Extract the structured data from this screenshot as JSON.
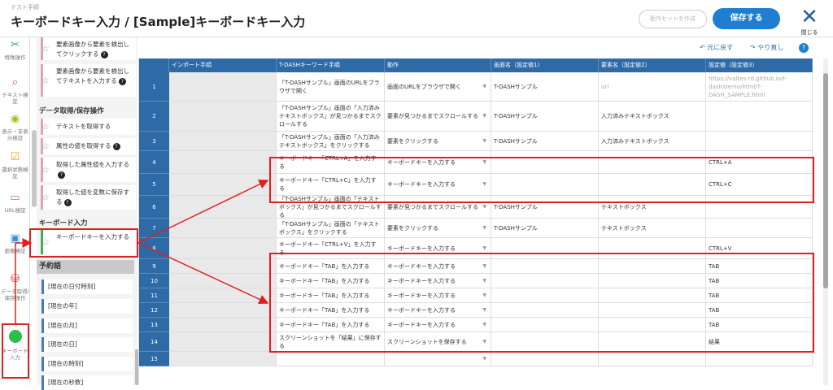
{
  "header": {
    "breadcrumb": "テスト手順",
    "title": "キーボードキー入力 / [Sample]キーボードキー入力",
    "secondary_button": "動作セットを作成",
    "save_button": "保存する",
    "close_label": "閉じる"
  },
  "rail": [
    {
      "label": "特殊操作",
      "icon": "tools-icon",
      "glyph": "✂",
      "color": "#3aaa55"
    },
    {
      "label": "テキスト検証",
      "icon": "magnifier-icon",
      "glyph": "⌕",
      "color": "#c44"
    },
    {
      "label": "表示・非表示検証",
      "icon": "eye-icon",
      "glyph": "◉",
      "color": "#9bc21e"
    },
    {
      "label": "選択状態検証",
      "icon": "checkbox-icon",
      "glyph": "☑",
      "color": "#e8a31a"
    },
    {
      "label": "URL検証",
      "icon": "url-icon",
      "glyph": "▭",
      "color": "#d66"
    },
    {
      "label": "画像検証",
      "icon": "image-icon",
      "glyph": "▣",
      "color": "#3a8fd0"
    },
    {
      "label": "データ取得/保存操作",
      "icon": "database-icon",
      "glyph": "⛁",
      "color": "#c43"
    },
    {
      "label": "キーボード入力",
      "icon": "keyboard-icon",
      "glyph": "",
      "color": "#2cbf4c"
    }
  ],
  "panel": {
    "items_top": [
      {
        "label": "要素画像から要素を検出してクリックする",
        "help": "?"
      },
      {
        "label": "要素画像から要素を検出してテキストを入力する",
        "help": "?"
      }
    ],
    "section_data": "データ取得/保存操作",
    "items_data": [
      {
        "label": "テキストを取得する",
        "help": ""
      },
      {
        "label": "属性の値を取得する",
        "help": "?"
      },
      {
        "label": "取得した属性値を入力する",
        "help": "?"
      },
      {
        "label": "取得した値を変数に保存する",
        "help": "?"
      }
    ],
    "section_keyboard": "キーボード入力",
    "keyboard_item": "キーボードキーを入力する",
    "section_reserved": "予約語",
    "reserved": [
      "[現在の日付時刻]",
      "[現在の年]",
      "[現在の月]",
      "[現在の日]",
      "[現在の時刻]",
      "[現在の秒数]"
    ]
  },
  "toolbar": {
    "undo": "元に戻す",
    "redo": "やり直し",
    "help": "?"
  },
  "grid": {
    "columns": [
      "インポート手順",
      "T-DASHキーワード手順",
      "動作",
      "画面名（設定値1）",
      "要素名（設定値2）",
      "設定値（設定値3）"
    ],
    "rows": [
      {
        "num": "1",
        "step": "「T-DASHサンプル」画面のURLをブラウザで開く",
        "action": "画面のURLをブラウザで開く",
        "v1": "T-DASHサンプル",
        "v2": "url",
        "v3": "https://valtes-rd.github.io/t-dash/demo/html/T-DASH_SAMPLE.html"
      },
      {
        "num": "2",
        "step": "「T-DASHサンプル」画面の「入力済みテキストボックス」が見つかるまでスクロールする",
        "action": "要素が見つかるまでスクロールする",
        "v1": "T-DASHサンプル",
        "v2": "入力済みテキストボックス",
        "v3": ""
      },
      {
        "num": "3",
        "step": "「T-DASHサンプル」画面の「入力済みテキストボックス」をクリックする",
        "action": "要素をクリックする",
        "v1": "T-DASHサンプル",
        "v2": "入力済みテキストボックス",
        "v3": ""
      },
      {
        "num": "4",
        "step": "キーボードキー「CTRL+A」を入力する",
        "action": "キーボードキーを入力する",
        "v1": "",
        "v2": "",
        "v3": "CTRL+A"
      },
      {
        "num": "5",
        "step": "キーボードキー「CTRL+C」を入力する",
        "action": "キーボードキーを入力する",
        "v1": "",
        "v2": "",
        "v3": "CTRL+C"
      },
      {
        "num": "6",
        "step": "「T-DASHサンプル」画面の「テキストボックス」が見つかるまでスクロールする",
        "action": "要素が見つかるまでスクロールする",
        "v1": "T-DASHサンプル",
        "v2": "テキストボックス",
        "v3": ""
      },
      {
        "num": "7",
        "step": "「T-DASHサンプル」画面の「テキストボックス」をクリックする",
        "action": "要素をクリックする",
        "v1": "T-DASHサンプル",
        "v2": "テキストボックス",
        "v3": ""
      },
      {
        "num": "8",
        "step": "キーボードキー「CTRL+V」を入力する",
        "action": "キーボードキーを入力する",
        "v1": "",
        "v2": "",
        "v3": "CTRL+V"
      },
      {
        "num": "9",
        "step": "キーボードキー「TAB」を入力する",
        "action": "キーボードキーを入力する",
        "v1": "",
        "v2": "",
        "v3": "TAB"
      },
      {
        "num": "10",
        "step": "キーボードキー「TAB」を入力する",
        "action": "キーボードキーを入力する",
        "v1": "",
        "v2": "",
        "v3": "TAB"
      },
      {
        "num": "11",
        "step": "キーボードキー「TAB」を入力する",
        "action": "キーボードキーを入力する",
        "v1": "",
        "v2": "",
        "v3": "TAB"
      },
      {
        "num": "12",
        "step": "キーボードキー「TAB」を入力する",
        "action": "キーボードキーを入力する",
        "v1": "",
        "v2": "",
        "v3": "TAB"
      },
      {
        "num": "13",
        "step": "キーボードキー「TAB」を入力する",
        "action": "キーボードキーを入力する",
        "v1": "",
        "v2": "",
        "v3": "TAB"
      },
      {
        "num": "14",
        "step": "スクリーンショットを「結果」に保存する",
        "action": "スクリーンショットを保存する",
        "v1": "",
        "v2": "",
        "v3": "結果"
      },
      {
        "num": "15",
        "step": "",
        "action": "",
        "v1": "",
        "v2": "",
        "v3": ""
      }
    ]
  },
  "colors": {
    "header_blue": "#2d6aa6",
    "accent": "#1e7fd1",
    "highlight": "#e02020",
    "keyboard_green": "#2cbf4c"
  }
}
